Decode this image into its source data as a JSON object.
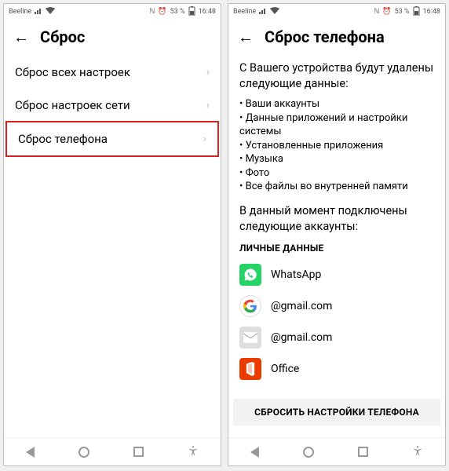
{
  "statusbar": {
    "carrier": "Beeline",
    "battery": "53 %",
    "time": "16:48"
  },
  "screen1": {
    "title": "Сброс",
    "items": [
      {
        "label": "Сброс всех настроек"
      },
      {
        "label": "Сброс настроек сети"
      },
      {
        "label": "Сброс телефона"
      }
    ]
  },
  "screen2": {
    "title": "Сброс телефона",
    "warning": "С Вашего устройства будут удалены следующие данные:",
    "bullets": [
      "Ваши аккаунты",
      "Данные приложений и настройки системы",
      "Установленные приложения",
      "Музыка",
      "Фото",
      "Все файлы во внутренней памяти"
    ],
    "accounts_intro": "В данный момент подключены следующие аккаунты:",
    "section_title": "ЛИЧНЫЕ ДАННЫЕ",
    "accounts": [
      {
        "name": "WhatsApp"
      },
      {
        "name": "@gmail.com"
      },
      {
        "name": "@gmail.com"
      },
      {
        "name": "Office"
      }
    ],
    "reset_button": "СБРОСИТЬ НАСТРОЙКИ ТЕЛЕФОНА"
  }
}
